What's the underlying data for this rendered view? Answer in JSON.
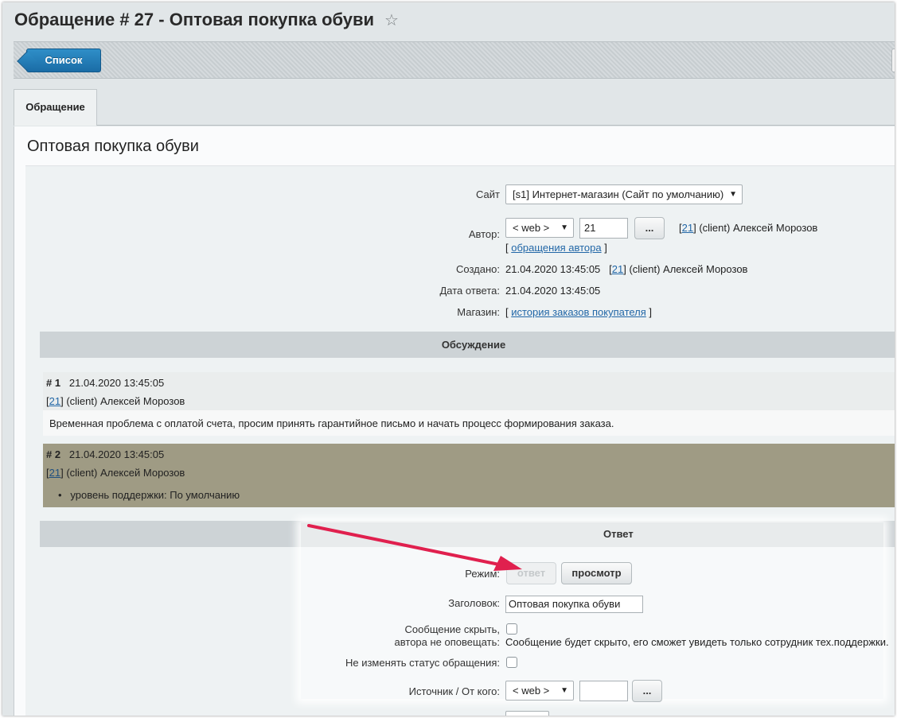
{
  "header": {
    "title": "Обращение # 27 - Оптовая покупка обуви",
    "star_icon": "star-icon"
  },
  "toolbar": {
    "list_label": "Список"
  },
  "tabs": [
    {
      "label": "Обращение"
    }
  ],
  "content": {
    "title": "Оптовая покупка обуви"
  },
  "form": {
    "site": {
      "label": "Сайт",
      "value": "[s1] Интернет-магазин (Сайт по умолчанию)"
    },
    "author": {
      "label": "Автор:",
      "select": "< web >",
      "id": "21",
      "browse": "...",
      "info_id": "21",
      "info_text": "(client) Алексей Морозов",
      "link": "обращения автора"
    },
    "created": {
      "label": "Создано:",
      "date": "21.04.2020 13:45:05",
      "user_id": "21",
      "user_text": "(client) Алексей Морозов"
    },
    "answer_date": {
      "label": "Дата ответа:",
      "value": "21.04.2020 13:45:05"
    },
    "shop": {
      "label": "Магазин:",
      "link": "история заказов покупателя"
    }
  },
  "discussion": {
    "title": "Обсуждение",
    "messages": [
      {
        "num": "# 1",
        "date": "21.04.2020 13:45:05",
        "user_id": "21",
        "user_text": "(client) Алексей Морозов",
        "text": "Временная проблема с оплатой счета,  просим принять гарантийное письмо и начать процесс формирования заказа."
      },
      {
        "num": "# 2",
        "date": "21.04.2020 13:45:05",
        "user_id": "21",
        "user_text": "(client) Алексей Морозов",
        "bullet": "уровень поддержки: По умолчанию"
      }
    ]
  },
  "reply": {
    "title": "Ответ",
    "mode": {
      "label": "Режим:",
      "answer_btn": "ответ",
      "preview_btn": "просмотр"
    },
    "subject": {
      "label": "Заголовок:",
      "value": "Оптовая покупка обуви"
    },
    "hide": {
      "label_line1": "Сообщение скрыть,",
      "label_line2": "автора не оповещать:",
      "note": "Сообщение будет скрыто, его сможет увидеть только сотрудник тех.поддержки."
    },
    "keep_status": {
      "label": "Не изменять статус обращения:"
    },
    "source": {
      "label": "Источник / От кого:",
      "select": "< web >",
      "browse": "..."
    }
  },
  "colors": {
    "accent_blue": "#1a6ca6",
    "link": "#2267a7",
    "message_2_bg": "#9f9b84",
    "arrow": "#e0204e"
  }
}
